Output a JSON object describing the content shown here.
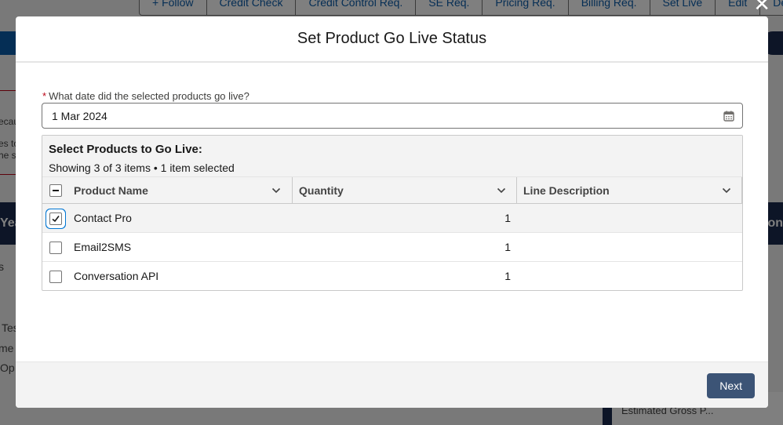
{
  "background": {
    "toolbar": [
      "+ Follow",
      "Credit Check",
      "Credit Control Req.",
      "SE Req.",
      "Pricing Req.",
      "Billing Req.",
      "Set Live",
      "Edit",
      "De"
    ],
    "fragments": {
      "ecau": "ecau",
      "es_to": "es to",
      "he_s": "he s",
      "yea": "Yea",
      "on": "on",
      "s": "s",
      "tes": "Tes",
      "me": "me",
      "op": "Op",
      "estimated": "Estimated Gross P..."
    }
  },
  "modal": {
    "title": "Set Product Go Live Status",
    "date_field": {
      "label": "What date did the selected products go live?",
      "required_mark": "*",
      "value": "1 Mar 2024"
    },
    "table": {
      "title": "Select Products to Go Live:",
      "summary": "Showing 3 of 3 items • 1 item selected",
      "columns": [
        "Product Name",
        "Quantity",
        "Line Description"
      ],
      "rows": [
        {
          "name": "Contact Pro",
          "quantity": "1",
          "description": "",
          "selected": true
        },
        {
          "name": "Email2SMS",
          "quantity": "1",
          "description": "",
          "selected": false
        },
        {
          "name": "Conversation API",
          "quantity": "1",
          "description": "",
          "selected": false
        }
      ]
    },
    "footer": {
      "next_label": "Next"
    }
  },
  "colors": {
    "brand": "#0176d3",
    "button": "#3c5476",
    "required": "#ba0517"
  }
}
